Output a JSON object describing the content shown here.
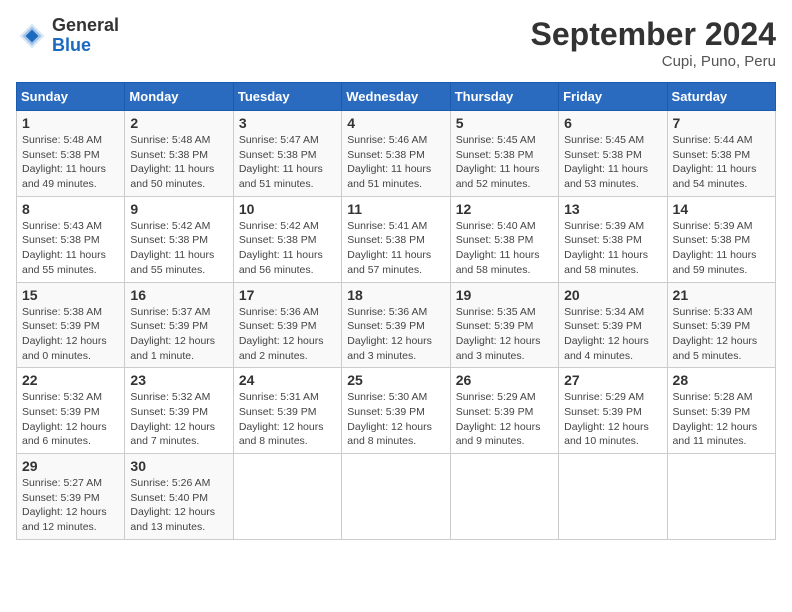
{
  "logo": {
    "line1": "General",
    "line2": "Blue"
  },
  "title": "September 2024",
  "subtitle": "Cupi, Puno, Peru",
  "days_of_week": [
    "Sunday",
    "Monday",
    "Tuesday",
    "Wednesday",
    "Thursday",
    "Friday",
    "Saturday"
  ],
  "weeks": [
    [
      {
        "day": "1",
        "sunrise": "5:48 AM",
        "sunset": "5:38 PM",
        "daylight": "11 hours and 49 minutes."
      },
      {
        "day": "2",
        "sunrise": "5:48 AM",
        "sunset": "5:38 PM",
        "daylight": "11 hours and 50 minutes."
      },
      {
        "day": "3",
        "sunrise": "5:47 AM",
        "sunset": "5:38 PM",
        "daylight": "11 hours and 51 minutes."
      },
      {
        "day": "4",
        "sunrise": "5:46 AM",
        "sunset": "5:38 PM",
        "daylight": "11 hours and 51 minutes."
      },
      {
        "day": "5",
        "sunrise": "5:45 AM",
        "sunset": "5:38 PM",
        "daylight": "11 hours and 52 minutes."
      },
      {
        "day": "6",
        "sunrise": "5:45 AM",
        "sunset": "5:38 PM",
        "daylight": "11 hours and 53 minutes."
      },
      {
        "day": "7",
        "sunrise": "5:44 AM",
        "sunset": "5:38 PM",
        "daylight": "11 hours and 54 minutes."
      }
    ],
    [
      {
        "day": "8",
        "sunrise": "5:43 AM",
        "sunset": "5:38 PM",
        "daylight": "11 hours and 55 minutes."
      },
      {
        "day": "9",
        "sunrise": "5:42 AM",
        "sunset": "5:38 PM",
        "daylight": "11 hours and 55 minutes."
      },
      {
        "day": "10",
        "sunrise": "5:42 AM",
        "sunset": "5:38 PM",
        "daylight": "11 hours and 56 minutes."
      },
      {
        "day": "11",
        "sunrise": "5:41 AM",
        "sunset": "5:38 PM",
        "daylight": "11 hours and 57 minutes."
      },
      {
        "day": "12",
        "sunrise": "5:40 AM",
        "sunset": "5:38 PM",
        "daylight": "11 hours and 58 minutes."
      },
      {
        "day": "13",
        "sunrise": "5:39 AM",
        "sunset": "5:38 PM",
        "daylight": "11 hours and 58 minutes."
      },
      {
        "day": "14",
        "sunrise": "5:39 AM",
        "sunset": "5:38 PM",
        "daylight": "11 hours and 59 minutes."
      }
    ],
    [
      {
        "day": "15",
        "sunrise": "5:38 AM",
        "sunset": "5:39 PM",
        "daylight": "12 hours and 0 minutes."
      },
      {
        "day": "16",
        "sunrise": "5:37 AM",
        "sunset": "5:39 PM",
        "daylight": "12 hours and 1 minute."
      },
      {
        "day": "17",
        "sunrise": "5:36 AM",
        "sunset": "5:39 PM",
        "daylight": "12 hours and 2 minutes."
      },
      {
        "day": "18",
        "sunrise": "5:36 AM",
        "sunset": "5:39 PM",
        "daylight": "12 hours and 3 minutes."
      },
      {
        "day": "19",
        "sunrise": "5:35 AM",
        "sunset": "5:39 PM",
        "daylight": "12 hours and 3 minutes."
      },
      {
        "day": "20",
        "sunrise": "5:34 AM",
        "sunset": "5:39 PM",
        "daylight": "12 hours and 4 minutes."
      },
      {
        "day": "21",
        "sunrise": "5:33 AM",
        "sunset": "5:39 PM",
        "daylight": "12 hours and 5 minutes."
      }
    ],
    [
      {
        "day": "22",
        "sunrise": "5:32 AM",
        "sunset": "5:39 PM",
        "daylight": "12 hours and 6 minutes."
      },
      {
        "day": "23",
        "sunrise": "5:32 AM",
        "sunset": "5:39 PM",
        "daylight": "12 hours and 7 minutes."
      },
      {
        "day": "24",
        "sunrise": "5:31 AM",
        "sunset": "5:39 PM",
        "daylight": "12 hours and 8 minutes."
      },
      {
        "day": "25",
        "sunrise": "5:30 AM",
        "sunset": "5:39 PM",
        "daylight": "12 hours and 8 minutes."
      },
      {
        "day": "26",
        "sunrise": "5:29 AM",
        "sunset": "5:39 PM",
        "daylight": "12 hours and 9 minutes."
      },
      {
        "day": "27",
        "sunrise": "5:29 AM",
        "sunset": "5:39 PM",
        "daylight": "12 hours and 10 minutes."
      },
      {
        "day": "28",
        "sunrise": "5:28 AM",
        "sunset": "5:39 PM",
        "daylight": "12 hours and 11 minutes."
      }
    ],
    [
      {
        "day": "29",
        "sunrise": "5:27 AM",
        "sunset": "5:39 PM",
        "daylight": "12 hours and 12 minutes."
      },
      {
        "day": "30",
        "sunrise": "5:26 AM",
        "sunset": "5:40 PM",
        "daylight": "12 hours and 13 minutes."
      },
      null,
      null,
      null,
      null,
      null
    ]
  ],
  "labels": {
    "sunrise": "Sunrise:",
    "sunset": "Sunset:",
    "daylight": "Daylight:"
  }
}
